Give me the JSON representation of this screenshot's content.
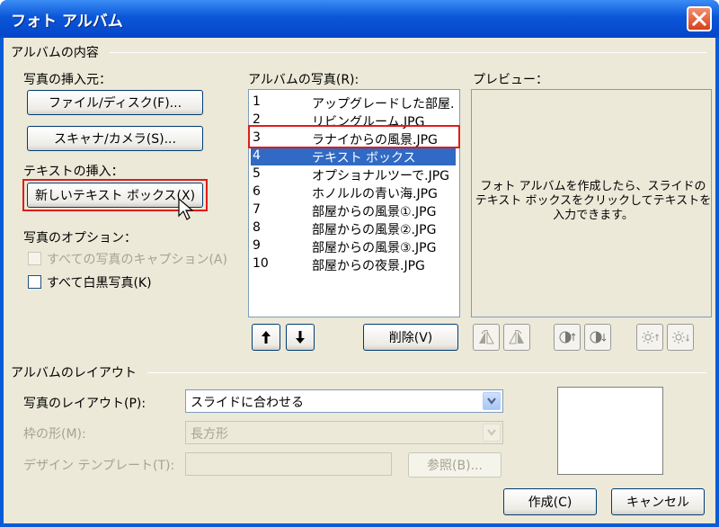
{
  "window": {
    "title": "フォト アルバム"
  },
  "content_group": {
    "title": "アルバムの内容"
  },
  "insert_from": {
    "label": "写真の挿入元：",
    "file_button": "ファイル/ディスク(F)...",
    "scanner_button": "スキャナ/カメラ(S)..."
  },
  "text_insert": {
    "label": "テキストの挿入：",
    "new_textbox_button": "新しいテキスト ボックス(X)"
  },
  "photo_options": {
    "label": "写真のオプション：",
    "captions_label": "すべての写真のキャプション(A)",
    "bw_label": "すべて白黒写真(K)"
  },
  "album_photos": {
    "label": "アルバムの写真(R):",
    "items": [
      {
        "num": "1",
        "name": "アップグレードした部屋."
      },
      {
        "num": "2",
        "name": "リビングルーム.JPG"
      },
      {
        "num": "3",
        "name": "ラナイからの風景.JPG"
      },
      {
        "num": "4",
        "name": "テキスト ボックス"
      },
      {
        "num": "5",
        "name": "オプショナルツーで.JPG"
      },
      {
        "num": "6",
        "name": "ホノルルの青い海.JPG"
      },
      {
        "num": "7",
        "name": "部屋からの風景①.JPG"
      },
      {
        "num": "8",
        "name": "部屋からの風景②.JPG"
      },
      {
        "num": "9",
        "name": "部屋からの風景③.JPG"
      },
      {
        "num": "10",
        "name": "部屋からの夜景.JPG"
      }
    ],
    "selected_index": 3,
    "delete_button": "削除(V)"
  },
  "preview": {
    "label": "プレビュー：",
    "message_line1": "フォト アルバムを作成したら、スライドの",
    "message_line2": "テキスト ボックスをクリックしてテキストを",
    "message_line3": "入力できます。"
  },
  "layout_group": {
    "title": "アルバムのレイアウト",
    "picture_layout_label": "写真のレイアウト(P):",
    "picture_layout_value": "スライドに合わせる",
    "frame_shape_label": "枠の形(M):",
    "frame_shape_value": "長方形",
    "design_template_label": "デザイン テンプレート(T):",
    "design_template_value": "",
    "browse_button": "参照(B)..."
  },
  "footer": {
    "create_button": "作成(C)",
    "cancel_button": "キャンセル"
  },
  "colors": {
    "title_bar": "#0b56d8",
    "selection": "#316ac5",
    "highlight_box": "#e01c1c",
    "dialog_bg": "#ece9d8"
  }
}
